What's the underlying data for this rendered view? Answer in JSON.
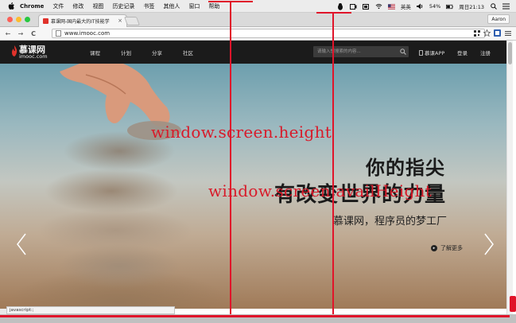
{
  "menubar": {
    "app": "Chrome",
    "items": [
      "文件",
      "修改",
      "视图",
      "历史记录",
      "书签",
      "其他人",
      "窗口",
      "帮助"
    ],
    "input_method": "英英",
    "battery": "54%",
    "clock": "周日21:13"
  },
  "tab": {
    "title": "慕课网-国内最大的IT技能学",
    "close": "×"
  },
  "profile": {
    "name": "Aaron"
  },
  "toolbar": {
    "url": "www.imooc.com",
    "back": "←",
    "forward": "→",
    "reload": "C"
  },
  "site": {
    "logo_cn": "慕课网",
    "logo_en": "imooc.com",
    "nav": [
      "课程",
      "计划",
      "分享",
      "社区"
    ],
    "search_placeholder": "请输入想搜索的内容...",
    "app_link": "慕课APP",
    "login": "登录",
    "register": "注册",
    "headline1": "你的指尖",
    "headline2": "有改变世界的力量",
    "tagline": "慕课网，程序员的梦工厂",
    "more": "了解更多",
    "more_icon": "▸"
  },
  "annotations": {
    "screen_height": "window.screen.height",
    "avail_height": "window.screen.availHeight"
  },
  "status_text": "javascript:;",
  "colors": {
    "accent_red": "#e0142a",
    "nav_bg": "#1b1b1b"
  }
}
